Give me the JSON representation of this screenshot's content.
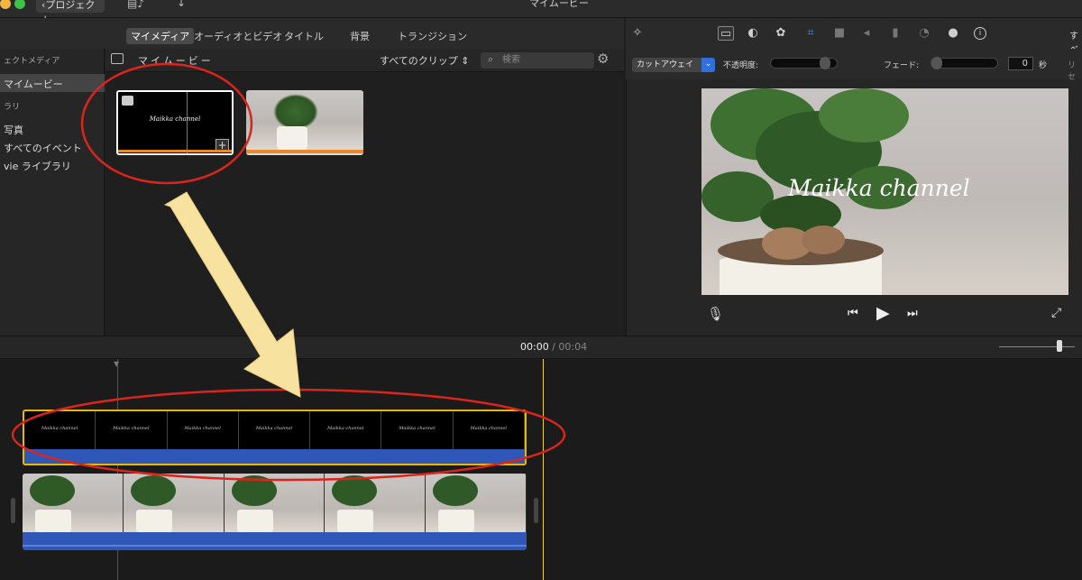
{
  "window": {
    "title": "マイムービー",
    "back_label": "プロジェクト"
  },
  "tabs": [
    {
      "label": "マイメディア"
    },
    {
      "label": "オーディオとビデオ"
    },
    {
      "label": "タイトル"
    },
    {
      "label": "背景"
    },
    {
      "label": "トランジション"
    }
  ],
  "sidebar": {
    "header": "ェクトメディア",
    "project": "マイムービー",
    "library_header": "ラリ",
    "items": [
      {
        "label": "写真"
      },
      {
        "label": "すべてのイベント"
      },
      {
        "label": "vie ライブラリ"
      }
    ]
  },
  "browser": {
    "title": "マイムービー",
    "filter": "すべてのクリップ",
    "search_placeholder": "検索",
    "clip_title": "Maikka channel"
  },
  "inspector": {
    "effect": "カットアウェイ",
    "opacity_label": "不透明度:",
    "fade_label": "フェード:",
    "fade_value": "0",
    "fade_unit": "秒",
    "reset": "リセ",
    "all": "すべ",
    "opacity_level": 0.85,
    "fade_level": 0.0
  },
  "viewer": {
    "overlay_title": "Maikka channel"
  },
  "timeline": {
    "current_time": "00:00",
    "separator": "/",
    "duration": "00:04",
    "title_frames": [
      "Maikka channel",
      "Maikka channel",
      "Maikka channel",
      "Maikka channel",
      "Maikka channel",
      "Maikka channel",
      "Maikka channel"
    ]
  },
  "colors": {
    "accent_blue": "#2f6fde",
    "clip_yellow": "#e6b800",
    "annotation_red": "#d9251c",
    "arrow_yellow": "#f8e2a0",
    "playhead": "#e8d24a"
  }
}
